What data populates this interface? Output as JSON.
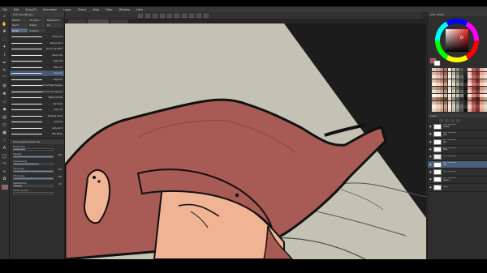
{
  "menu": [
    "File",
    "Edit",
    "Story(P)",
    "Animation",
    "Layer",
    "Select",
    "View",
    "Filter",
    "Window",
    "Help"
  ],
  "tabs": [
    {
      "label": "",
      "active": false
    },
    {
      "label": "",
      "active": true
    },
    {
      "label": "",
      "active": false
    }
  ],
  "tools": [
    {
      "name": "zoom-icon",
      "glyph": "⌕"
    },
    {
      "name": "hand-icon",
      "glyph": "✋"
    },
    {
      "name": "move-icon",
      "glyph": "✥"
    },
    {
      "name": "selection-icon",
      "glyph": "⬚"
    },
    {
      "name": "wand-icon",
      "glyph": "✦"
    },
    {
      "name": "eyedropper-icon",
      "glyph": "⌇"
    },
    {
      "name": "pen-icon",
      "glyph": "✒"
    },
    {
      "name": "pencil-icon",
      "glyph": "✎"
    },
    {
      "name": "brush-icon",
      "glyph": "⌒"
    },
    {
      "name": "airbrush-icon",
      "glyph": "◍"
    },
    {
      "name": "decoration-icon",
      "glyph": "❀"
    },
    {
      "name": "eraser-icon",
      "glyph": "▱"
    },
    {
      "name": "fill-icon",
      "glyph": "◆"
    },
    {
      "name": "gradient-icon",
      "glyph": "▤"
    },
    {
      "name": "figure-icon",
      "glyph": "◻"
    },
    {
      "name": "frame-icon",
      "glyph": "▣"
    },
    {
      "name": "ruler-icon",
      "glyph": "⟋"
    },
    {
      "name": "text-icon",
      "glyph": "A"
    },
    {
      "name": "balloon-icon",
      "glyph": "◯"
    },
    {
      "name": "correct-line-icon",
      "glyph": "⤳"
    },
    {
      "name": "blend-icon",
      "glyph": "≈"
    },
    {
      "name": "liquify-icon",
      "glyph": "✿"
    }
  ],
  "colors": {
    "main": "#a85a55",
    "sub": "#ffffff",
    "accent": "#465a74"
  },
  "subtool": {
    "header": "Sub Tool [Brush]",
    "tabs": [
      {
        "label": "Marker",
        "active": false
      },
      {
        "label": "Oil paint",
        "active": false
      },
      {
        "label": "Watercolor",
        "active": false
      },
      {
        "label": "Pencil",
        "active": false
      },
      {
        "label": "Pastel",
        "active": false
      },
      {
        "label": "Ink",
        "active": false
      },
      {
        "label": "Brush",
        "active": true
      },
      {
        "label": "Realistic",
        "active": false
      }
    ],
    "brushes": [
      {
        "name": "Round ink",
        "active": false
      },
      {
        "name": "Round ink 2",
        "active": false
      },
      {
        "name": "Round ink SOFT",
        "active": false
      },
      {
        "name": "Round ink",
        "active": false
      },
      {
        "name": "Base ink",
        "active": false
      },
      {
        "name": "Base ink",
        "active": false
      },
      {
        "name": "Save Ink",
        "active": true
      },
      {
        "name": "Base Ink",
        "active": false
      },
      {
        "name": "Round New Opaque",
        "active": false
      },
      {
        "name": "Round Less Opaque",
        "active": false
      },
      {
        "name": "Base hard tail",
        "active": false
      },
      {
        "name": "Ink brush",
        "active": false
      },
      {
        "name": "Lady ink",
        "active": false
      },
      {
        "name": "Shading brush",
        "active": false
      },
      {
        "name": "Lady ink",
        "active": false
      },
      {
        "name": "Lady ink 2",
        "active": false
      },
      {
        "name": "Hair Brush",
        "active": false
      }
    ],
    "prop_header": "Tool property [Save Ink]",
    "props": [
      {
        "label": "Brush Size",
        "value": "",
        "fill": 0.3
      },
      {
        "label": "Opacity",
        "value": "100",
        "fill": 1
      },
      {
        "label": "Anti-aliasing",
        "value": "",
        "fill": 0.65
      },
      {
        "label": "Thickness",
        "value": "100",
        "fill": 1
      },
      {
        "label": "Thickness",
        "value": "100",
        "fill": 1
      },
      {
        "label": "Stabilization",
        "value": "20",
        "fill": 0.2
      },
      {
        "label": "Vector eraser",
        "value": "",
        "fill": 0
      }
    ]
  },
  "right_panel": {
    "color_header": "Color Wheel",
    "layer_header": "Layer",
    "layers": [
      {
        "line1": "100 % Normal",
        "line2": "Lineart",
        "thumb": "#ffffff",
        "active": false
      },
      {
        "line1": "100 % Normal",
        "line2": "Hair",
        "thumb": "#ffffff",
        "active": false
      },
      {
        "line1": "100 % Normal",
        "line2": "Skin",
        "thumb": "#ffffff",
        "active": false
      },
      {
        "line1": "100 % Normal",
        "line2": "Body",
        "thumb": "#ffffff",
        "active": false
      },
      {
        "line1": "100 % Normal",
        "line2": "",
        "thumb": "#eeeeee",
        "active": false
      },
      {
        "line1": "100 % Normal",
        "line2": "Hair",
        "thumb": "#ffffff",
        "active": true
      },
      {
        "line1": "100 % Normal",
        "line2": "",
        "thumb": "#ffffff",
        "active": false
      },
      {
        "line1": "100 % Normal",
        "line2": "Layer 1",
        "thumb": "#ffffff",
        "active": false
      },
      {
        "line1": "",
        "line2": "Paper",
        "thumb": "#ffffff",
        "active": false
      }
    ]
  },
  "palette": [
    "#e7c6b4",
    "#d9a99a",
    "#c48b7e",
    "#a86a61",
    "#fbe8dc",
    "#c9c2a7",
    "#8e8a7b",
    "#555555",
    "#333333",
    "#f0d6cf",
    "#b55b57",
    "#8a3f3d",
    "#f2b7a3",
    "#e6d7cc",
    "#d7b6a4",
    "#c79b8a",
    "#b37a6b",
    "#a46254",
    "#f2dcd0",
    "#b9b49c",
    "#7b786c",
    "#444444",
    "#272727",
    "#efc4b9",
    "#a14c48",
    "#74312f",
    "#e9a690",
    "#dccbbd",
    "#f5e5d6",
    "#e8c8b3",
    "#d5a88f",
    "#c08a74",
    "#fdf1e8",
    "#d8d3c0",
    "#a29e8f",
    "#666666",
    "#1a1a1a",
    "#f7d8d1",
    "#c76864",
    "#92433f",
    "#f6c3b1",
    "#efe1d6",
    "#e3bca6",
    "#cf9e85",
    "#b9806a",
    "#9f654f",
    "#fae7db",
    "#c2bda6",
    "#86837a",
    "#4b4b4b",
    "#0e0e0e",
    "#e9b3a8",
    "#b05753",
    "#6d2b29",
    "#e39c86",
    "#d1bfaf",
    "#fdf4ec",
    "#f3dccb",
    "#e4bfa7",
    "#d3a286",
    "#ffffff",
    "#e4e0cf",
    "#b5b1a3",
    "#777777",
    "#2f2f2f",
    "#fbe3dd",
    "#d27470",
    "#9e4e4a",
    "#f9cebd",
    "#f5ebe2",
    "#caa48e",
    "#b88a72",
    "#a0715b",
    "#865944",
    "#f1d5c5",
    "#aaa58f",
    "#707066",
    "#3a3a3a",
    "#121212",
    "#dba096",
    "#993f3b",
    "#5c2422",
    "#d68e78",
    "#c4b1a0",
    "#ede0d3",
    "#dcc4b3",
    "#c6a896",
    "#b38d7a",
    "#f8ece2",
    "#cbc7b2",
    "#999587",
    "#5e5e5e",
    "#242424",
    "#f3cbc3",
    "#bb605c",
    "#833a37",
    "#eeb09c",
    "#e2d3c6",
    "#fffaf5",
    "#f6e6d9",
    "#e9d0bd",
    "#d9b8a1",
    "#fff5ee",
    "#dfdbc8",
    "#c4c0b1",
    "#888888",
    "#161616",
    "#fdeae5",
    "#dd827e",
    "#a85a55",
    "#fbd7c8",
    "#f8f0e8",
    "#b08872",
    "#9d725b",
    "#855c47",
    "#6a4433",
    "#e8c9b6",
    "#8f8b76",
    "#5c5c53",
    "#2a2a2a",
    "#080808",
    "#c88579",
    "#82322f",
    "#4a1c1a",
    "#c47c66",
    "#b39f8e",
    "#d8b9a4",
    "#c69e88",
    "#b0846e",
    "#977059",
    "#eed1bf",
    "#b6b19b",
    "#7f7c72",
    "#404040",
    "#1f1f1f",
    "#dea59b",
    "#a44d49",
    "#6a2a28",
    "#dd987f",
    "#cfbcab",
    "#f9ebe0",
    "#eed3c1",
    "#debba4",
    "#c99f87",
    "#fcf0e7",
    "#d2cdb9",
    "#a6a295",
    "#6a6a6a",
    "#333333",
    "#f5cfc7",
    "#c36b67",
    "#8d3f3c",
    "#f1b9a5",
    "#eadbcf",
    "#ecd3c1",
    "#dbb9a3",
    "#c89d86",
    "#b0826b",
    "#f4ddce",
    "#bfba a4",
    "#8b887e",
    "#505050",
    "#0b0b0b",
    "#e4ada3",
    "#b2524e",
    "#773330",
    "#e5a48e",
    "#d8c6b7"
  ]
}
